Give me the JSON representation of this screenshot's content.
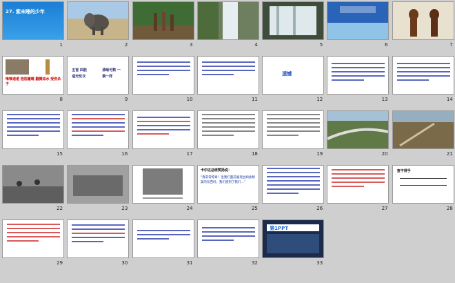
{
  "slides": [
    {
      "num": "1",
      "title": "27. 索未睡的少年"
    },
    {
      "num": "2"
    },
    {
      "num": "3"
    },
    {
      "num": "4"
    },
    {
      "num": "5"
    },
    {
      "num": "6"
    },
    {
      "num": "7"
    },
    {
      "num": "8",
      "red_text": "唯唯诺诺  抱怨撇嘴  翻腾如水  受伤杀子"
    },
    {
      "num": "9",
      "left_col": "五官 四肢 语无伦次",
      "right_col": "清晰可数 一模一样"
    },
    {
      "num": "10"
    },
    {
      "num": "11"
    },
    {
      "num": "12",
      "word": "遗憾"
    },
    {
      "num": "13"
    },
    {
      "num": "14"
    },
    {
      "num": "15"
    },
    {
      "num": "16"
    },
    {
      "num": "17"
    },
    {
      "num": "18"
    },
    {
      "num": "19"
    },
    {
      "num": "20"
    },
    {
      "num": "21"
    },
    {
      "num": "22"
    },
    {
      "num": "23"
    },
    {
      "num": "24"
    },
    {
      "num": "25",
      "heading": "卡尔达总统赞扬说：",
      "quote": "“我非常惊奇！当我们面前展现出如此精美的东西时，我们感到了我们…”"
    },
    {
      "num": "26"
    },
    {
      "num": "27"
    },
    {
      "num": "28",
      "heading": "查不得手"
    },
    {
      "num": "29"
    },
    {
      "num": "30"
    },
    {
      "num": "31"
    },
    {
      "num": "32"
    },
    {
      "num": "33",
      "brand": "第1PPT"
    }
  ],
  "colors": {
    "bg": "#cfcfcf",
    "accent_blue": "#2233aa",
    "accent_red": "#cc2222"
  }
}
